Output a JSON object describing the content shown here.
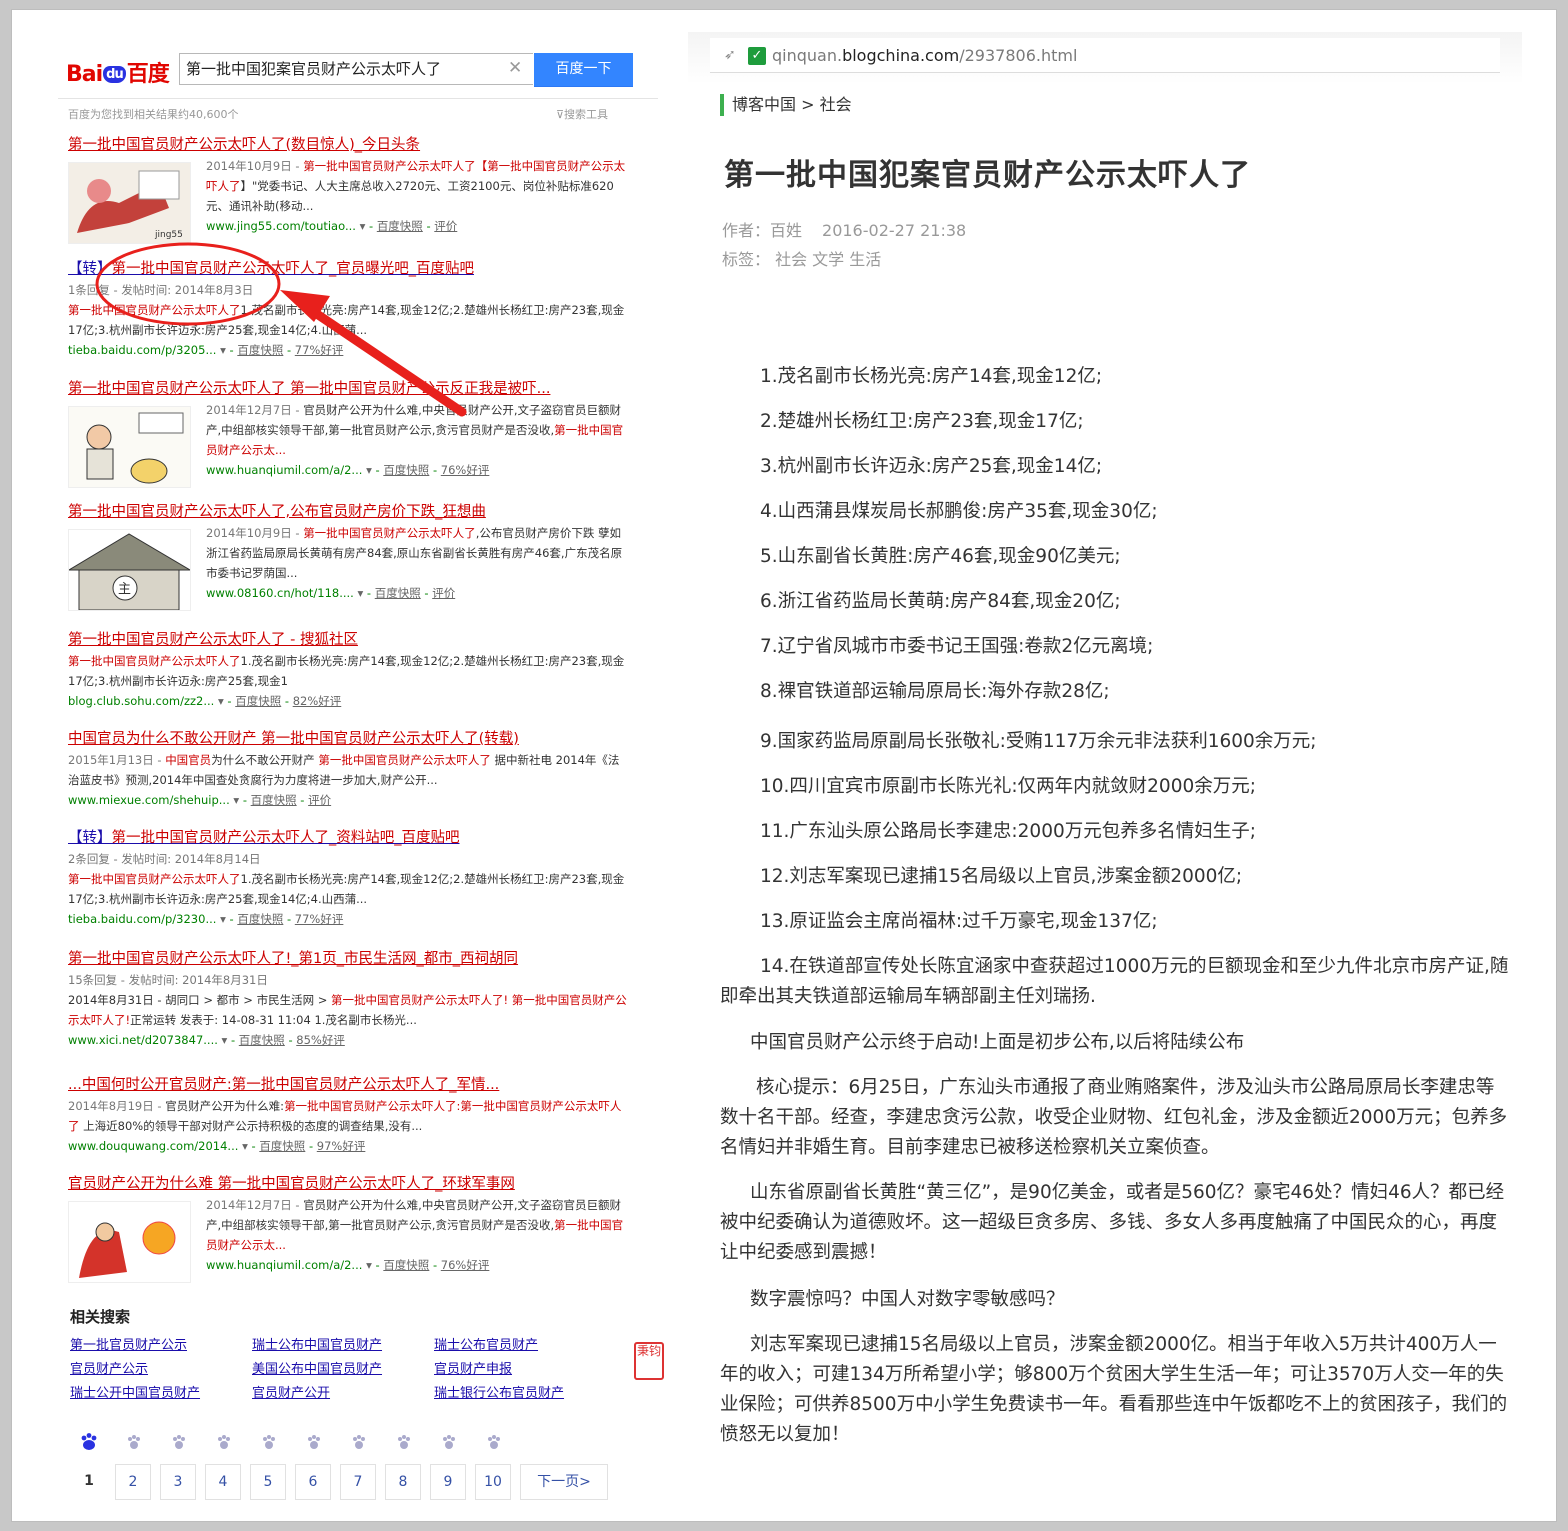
{
  "baidu": {
    "logo": {
      "bai": "Bai",
      "du": "du",
      "cn": "百度"
    },
    "search_value": "第一批中国犯案官员财产公示太吓人了",
    "search_button": "百度一下",
    "stats": "百度为您找到相关结果约40,600个",
    "tools": "搜索工具",
    "results": [
      {
        "title": "第一批中国官员财产公示太吓人了(数目惊人)_今日头条",
        "date": "2014年10月9日",
        "snippet_a": "第一批中国官员财产公示太吓人了【",
        "snippet_b": "第一批中国官员财产公示太吓人了",
        "snippet_c": "】\"党委书记、人大主席总收入2720元、工资2100元、岗位补贴标准620元、通讯补助(移动...",
        "url": "www.jing55.com/toutiao...",
        "cache": "百度快照",
        "extra": "评价"
      },
      {
        "title_prefix": "【转】",
        "title": "第一批中国官员财产公示太吓人了_官员曝光吧_百度贴吧",
        "meta": "1条回复 - 发帖时间: 2014年8月3日",
        "snippet_hl": "第一批中国官员财产公示太吓人了",
        "snippet": "1.茂名副市长杨光亮:房产14套,现金12亿;2.楚雄州长杨红卫:房产23套,现金17亿;3.杭州副市长许迈永:房产25套,现金14亿;4.山西蒲...",
        "url": "tieba.baidu.com/p/3205...",
        "cache": "百度快照",
        "extra": "77%好评"
      },
      {
        "title": "第一批中国官员财产公示太吓人了 第一批中国官员财产公示反正我是被吓...",
        "date": "2014年12月7日",
        "snippet_a": "官员财产公开为什么难,中央官员财产公开,文子盗窃官员巨额财产,中组部核实领导干部,第一批官员财产公示,贪污官员财产是否没收,",
        "snippet_b": "第一批中国官员财产公示太...",
        "url": "www.huanqiumil.com/a/2...",
        "cache": "百度快照",
        "extra": "76%好评"
      },
      {
        "title": "第一批中国官员财产公示太吓人了,公布官员财产房价下跌_狂想曲",
        "date": "2014年10月9日",
        "snippet_a": "第一批中国官员财产公示太吓人了",
        "snippet_c": ",公布官员财产房价下跌 孽如浙江省药监局原局长黄萌有房产84套,原山东省副省长黄胜有房产46套,广东茂名原市委书记罗荫国...",
        "url": "www.08160.cn/hot/118....",
        "cache": "百度快照",
        "extra": "评价"
      },
      {
        "title": "第一批中国官员财产公示太吓人了 - 搜狐社区",
        "snippet_hl": "第一批中国官员财产公示太吓人了",
        "snippet": "1.茂名副市长杨光亮:房产14套,现金12亿;2.楚雄州长杨红卫:房产23套,现金17亿;3.杭州副市长许迈永:房产25套,现金1",
        "url": "blog.club.sohu.com/zz2...",
        "cache": "百度快照",
        "extra": "82%好评"
      },
      {
        "title": "中国官员为什么不敢公开财产 第一批中国官员财产公示太吓人了(转载)",
        "date": "2015年1月13日",
        "snippet_hl1": "中国官员",
        "snippet_mid": "为什么不敢公开财产 ",
        "snippet_hl2": "第一批中国官员财产公示太吓人了",
        "snippet": " 据中新社电 2014年《法治蓝皮书》预测,2014年中国查处贪腐行为力度将进一步加大,财产公开...",
        "url": "www.miexue.com/shehuip...",
        "cache": "百度快照",
        "extra": "评价"
      },
      {
        "title_prefix": "【转】",
        "title": "第一批中国官员财产公示太吓人了_资料站吧_百度贴吧",
        "meta": "2条回复 - 发帖时间: 2014年8月14日",
        "snippet_hl": "第一批中国官员财产公示太吓人了",
        "snippet": "1.茂名副市长杨光亮:房产14套,现金12亿;2.楚雄州长杨红卫:房产23套,现金17亿;3.杭州副市长许迈永:房产25套,现金14亿;4.山西蒲...",
        "url": "tieba.baidu.com/p/3230...",
        "cache": "百度快照",
        "extra": "77%好评"
      },
      {
        "title": "第一批中国官员财产公示太吓人了!_第1页_市民生活网_都市_西祠胡同",
        "meta": "15条回复 - 发帖时间: 2014年8月31日",
        "snippet_pre": "2014年8月31日 - 胡同口 > 都市 > 市民生活网 > ",
        "snippet_hl": "第一批中国官员财产公示太吓人了! 第一批中国官员财产公示太吓人了!",
        "snippet": "正常运转 发表于: 14-08-31 11:04 1.茂名副市长杨光...",
        "url": "www.xici.net/d2073847....",
        "cache": "百度快照",
        "extra": "85%好评"
      },
      {
        "title": "...中国何时公开官员财产:第一批中国官员财产公示太吓人了_军情...",
        "date": "2014年8月19日",
        "snippet_a": "官员财产公开为什么难:",
        "snippet_b": "第一批中国官员财产公示太吓人了:第一批中国官员财产公示太吓人了",
        "snippet_c": " 上海近80%的领导干部对财产公示持积极的态度的调查结果,没有...",
        "url": "www.douquwang.com/2014...",
        "cache": "百度快照",
        "extra": "97%好评"
      },
      {
        "title": "官员财产公开为什么难 第一批中国官员财产公示太吓人了_环球军事网",
        "date": "2014年12月7日",
        "snippet_a": "官员财产公开为什么难,中央官员财产公开,文子盗窃官员巨额财产,中组部核实领导干部,第一批官员财产公示,贪污官员财产是否没收,",
        "snippet_b": "第一批中国官员财产公示太...",
        "url": "www.huanqiumil.com/a/2...",
        "cache": "百度快照",
        "extra": "76%好评"
      }
    ],
    "related_title": "相关搜索",
    "related": [
      "第一批官员财产公示",
      "瑞士公布中国官员财产",
      "瑞士公布官员财产",
      "官员财产公示",
      "美国公布中国官员财产",
      "官员财产申报",
      "瑞士公开中国官员财产",
      "官员财产公开",
      "瑞士银行公布官员财产"
    ],
    "seal_text": "秉钧",
    "pages": [
      "1",
      "2",
      "3",
      "4",
      "5",
      "6",
      "7",
      "8",
      "9",
      "10"
    ],
    "next_page": "下一页>"
  },
  "blog": {
    "url_domain": "qinquan.",
    "url_host": "blogchina.com",
    "url_path": "/2937806.html",
    "breadcrumb": "博客中国 > 社会",
    "title": "第一批中国犯案官员财产公示太吓人了",
    "author": "作者：百姓",
    "datetime": "2016-02-27 21:38",
    "tags": "标签： 社会 文学 生活",
    "paragraphs": [
      "1.茂名副市长杨光亮:房产14套,现金12亿;",
      "2.楚雄州长杨红卫:房产23套,现金17亿;",
      "3.杭州副市长许迈永:房产25套,现金14亿;",
      "4.山西蒲县煤炭局长郝鹏俊:房产35套,现金30亿;",
      "5.山东副省长黄胜:房产46套,现金90亿美元;",
      "6.浙江省药监局长黄萌:房产84套,现金20亿;",
      "7.辽宁省凤城市市委书记王国强:卷款2亿元离境;",
      "8.裸官铁道部运输局原局长:海外存款28亿;",
      "9.国家药监局原副局长张敬礼:受贿117万余元非法获利1600余万元;",
      "10.四川宜宾市原副市长陈光礼:仅两年内就敛财2000余万元;",
      "11.广东汕头原公路局长李建忠:2000万元包养多名情妇生子;",
      "12.刘志军案现已逮捕15名局级以上官员,涉案金额2000亿;",
      "13.原证监会主席尚福林:过千万豪宅,现金137亿;",
      "14.在铁道部宣传处长陈宜涵家中查获超过1000万元的巨额现金和至少九件北京市房产证,随即牵出其夫铁道部运输局车辆部副主任刘瑞扬.",
      "中国官员财产公示终于启动!上面是初步公布,以后将陆续公布",
      "核心提示：6月25日，广东汕头市通报了商业贿赂案件，涉及汕头市公路局原局长李建忠等数十名干部。经查，李建忠贪污公款，收受企业财物、红包礼金，涉及金额近2000万元；包养多名情妇并非婚生育。目前李建忠已被移送检察机关立案侦查。",
      "山东省原副省长黄胜“黄三亿”，是90亿美金，或者是560亿？豪宅46处？情妇46人？都已经被中纪委确认为道德败坏。这一超级巨贪多房、多钱、多女人多再度触痛了中国民众的心，再度让中纪委感到震撼！",
      "数字震惊吗？中国人对数字零敏感吗？",
      "刘志军案现已逮捕15名局级以上官员，涉案金额2000亿。相当于年收入5万共计400万人一年的收入；可建134万所希望小学；够800万个贫困大学生生活一年；可让3570万人交一年的失业保险；可供养8500万中小学生免费读书一年。看看那些连中午饭都吃不上的贫困孩子，我们的愤怒无以复加！"
    ]
  },
  "colors": {
    "link": "#1a0dab",
    "highlight": "#cc0000",
    "url_green": "#008000",
    "annotation_red": "#e8201c",
    "baidu_blue": "#3385ff"
  }
}
